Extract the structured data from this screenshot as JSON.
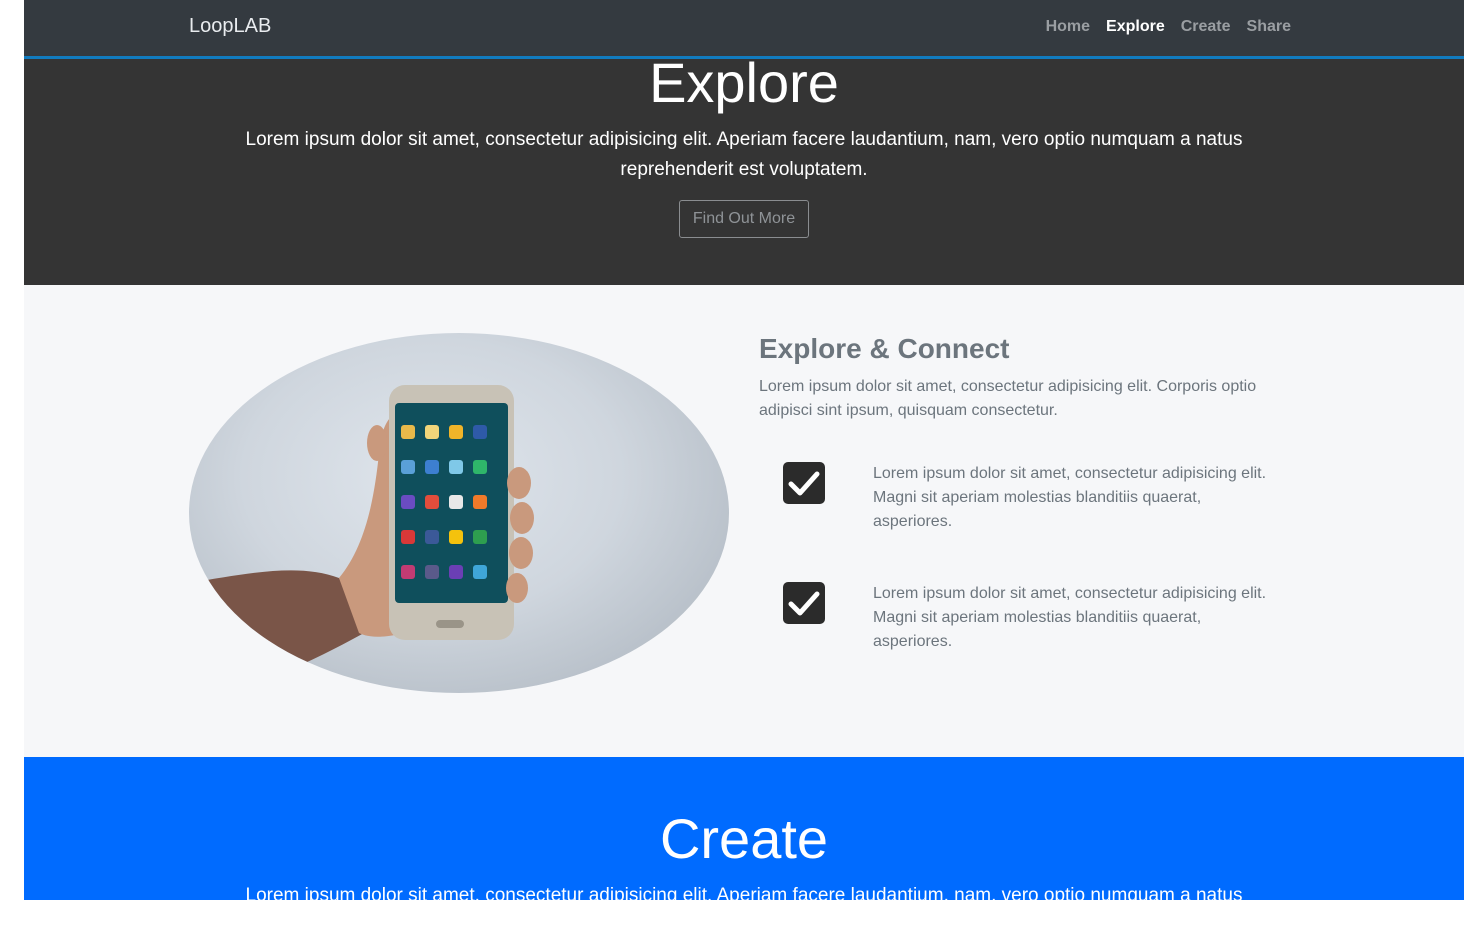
{
  "navbar": {
    "brand": "LoopLAB",
    "links": [
      {
        "label": "Home",
        "active": false
      },
      {
        "label": "Explore",
        "active": true
      },
      {
        "label": "Create",
        "active": false
      },
      {
        "label": "Share",
        "active": false
      }
    ]
  },
  "hero": {
    "title": "Explore",
    "text": "Lorem ipsum dolor sit amet, consectetur adipisicing elit. Aperiam facere laudantium, nam, vero optio numquam a natus reprehenderit est voluptatem.",
    "button_label": "Find Out More"
  },
  "connect": {
    "title": "Explore & Connect",
    "lead": "Lorem ipsum dolor sit amet, consectetur adipisicing elit. Corporis optio adipisci sint ipsum, quisquam consectetur.",
    "features": [
      {
        "icon": "check-square-icon",
        "text": "Lorem ipsum dolor sit amet, consectetur adipisicing elit. Magni sit aperiam molestias blanditiis quaerat, asperiores."
      },
      {
        "icon": "check-square-icon",
        "text": "Lorem ipsum dolor sit amet, consectetur adipisicing elit. Magni sit aperiam molestias blanditiis quaerat, asperiores."
      }
    ]
  },
  "create": {
    "title": "Create",
    "text": "Lorem ipsum dolor sit amet, consectetur adipisicing elit. Aperiam facere laudantium, nam, vero optio numquam a natus"
  },
  "colors": {
    "navbar": "#343a40",
    "navbar_border": "#117bbf",
    "hero_bg": "#343434",
    "section_bg": "#f6f7f9",
    "create_bg": "#006bff"
  }
}
